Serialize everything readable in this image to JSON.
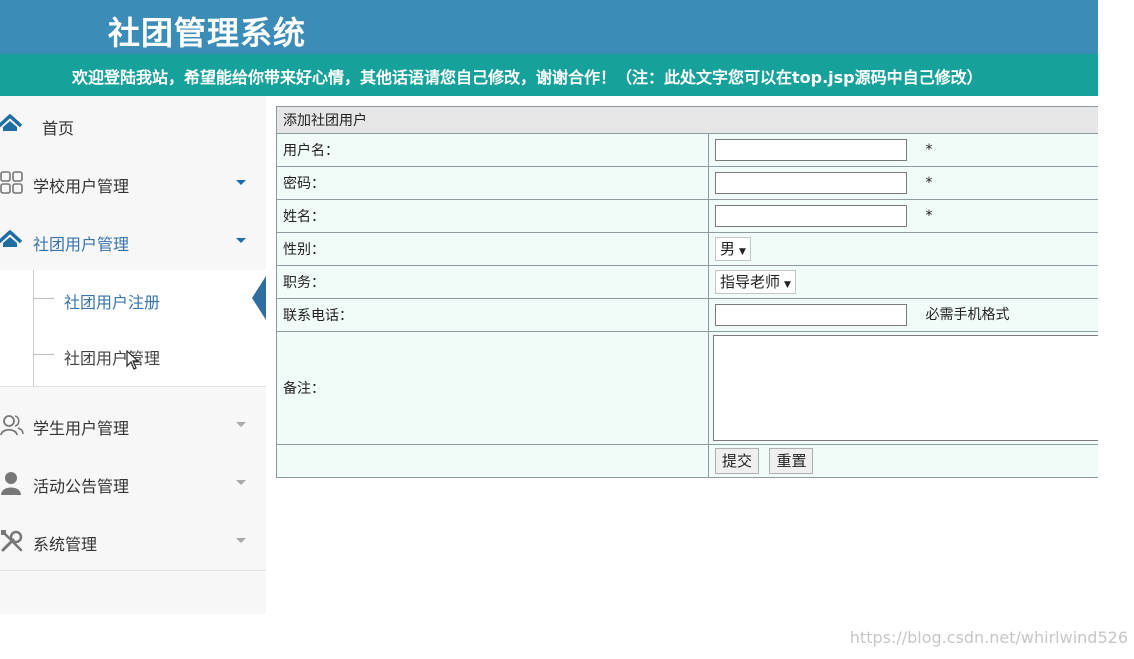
{
  "header": {
    "title": "社团管理系统",
    "marquee": "欢迎登陆我站，希望能给你带来好心情，其他话语请您自己修改，谢谢合作！（注：此处文字您可以在top.jsp源码中自己修改）"
  },
  "sidebar": {
    "home": "首页",
    "items": [
      {
        "label": "学校用户管理",
        "icon": "grid-icon"
      },
      {
        "label": "社团用户管理",
        "icon": "home-icon"
      },
      {
        "label": "学生用户管理",
        "icon": "users-icon"
      },
      {
        "label": "活动公告管理",
        "icon": "user-icon"
      },
      {
        "label": "系统管理",
        "icon": "tools-icon"
      }
    ],
    "submenu": [
      {
        "label": "社团用户注册"
      },
      {
        "label": "社团用户管理"
      }
    ]
  },
  "form": {
    "header": "添加社团用户",
    "username_label": "用户名：",
    "password_label": "密码：",
    "name_label": "姓名：",
    "gender_label": "性别：",
    "gender_value": "男",
    "position_label": "职务：",
    "position_value": "指导老师",
    "phone_label": "联系电话：",
    "phone_hint": "必需手机格式",
    "remark_label": "备注：",
    "required_mark": "*",
    "submit": "提交",
    "reset": "重置"
  },
  "watermark": "https://blog.csdn.net/whirlwind526",
  "colors": {
    "header": "#3c8cb8",
    "marquee": "#17a19b",
    "active": "#3a74a8"
  }
}
